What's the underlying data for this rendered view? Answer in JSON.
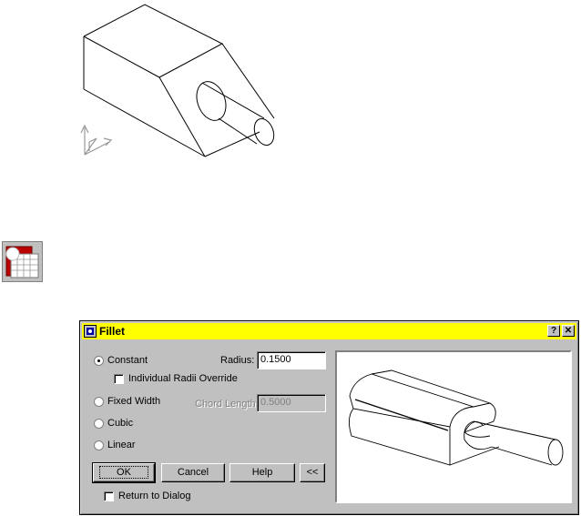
{
  "dialog": {
    "title": "Fillet",
    "help_btn": "?",
    "close_btn": "✕",
    "constant_label": "Constant",
    "radius_label": "Radius:",
    "radius_value": "0.1500",
    "individual_label": "Individual Radii Override",
    "fixed_width_label": "Fixed Width",
    "chord_label": "Chord Length:",
    "chord_value": "0.5000",
    "cubic_label": "Cubic",
    "linear_label": "Linear",
    "ok_label": "OK",
    "cancel_label": "Cancel",
    "help_label": "Help",
    "collapse_label": "<<",
    "return_label": "Return to Dialog",
    "selected_mode": "Constant"
  },
  "icons": {
    "toolbar_icon": "fillet-tool-icon",
    "ucs_icon": "ucs-axis-icon",
    "title_icon": "app-icon"
  }
}
